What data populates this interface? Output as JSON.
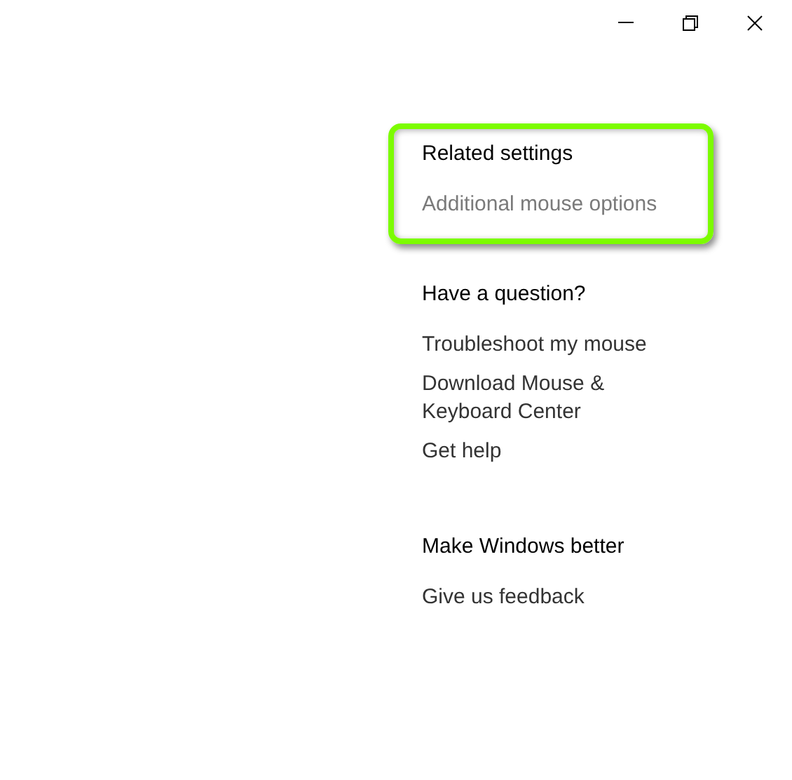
{
  "window": {
    "controls": [
      {
        "kind": "minimize"
      },
      {
        "kind": "restore"
      },
      {
        "kind": "close"
      }
    ]
  },
  "sections": [
    {
      "heading": "Related settings",
      "highlighted": true,
      "links": [
        {
          "label": "Additional mouse options",
          "dimmed": true
        }
      ]
    },
    {
      "heading": "Have a question?",
      "highlighted": false,
      "links": [
        {
          "label": "Troubleshoot my mouse",
          "dimmed": false
        },
        {
          "label": "Download Mouse & Keyboard Center",
          "dimmed": false
        },
        {
          "label": "Get help",
          "dimmed": false
        }
      ]
    },
    {
      "heading": "Make Windows better",
      "highlighted": false,
      "links": [
        {
          "label": "Give us feedback",
          "dimmed": false
        }
      ]
    }
  ]
}
